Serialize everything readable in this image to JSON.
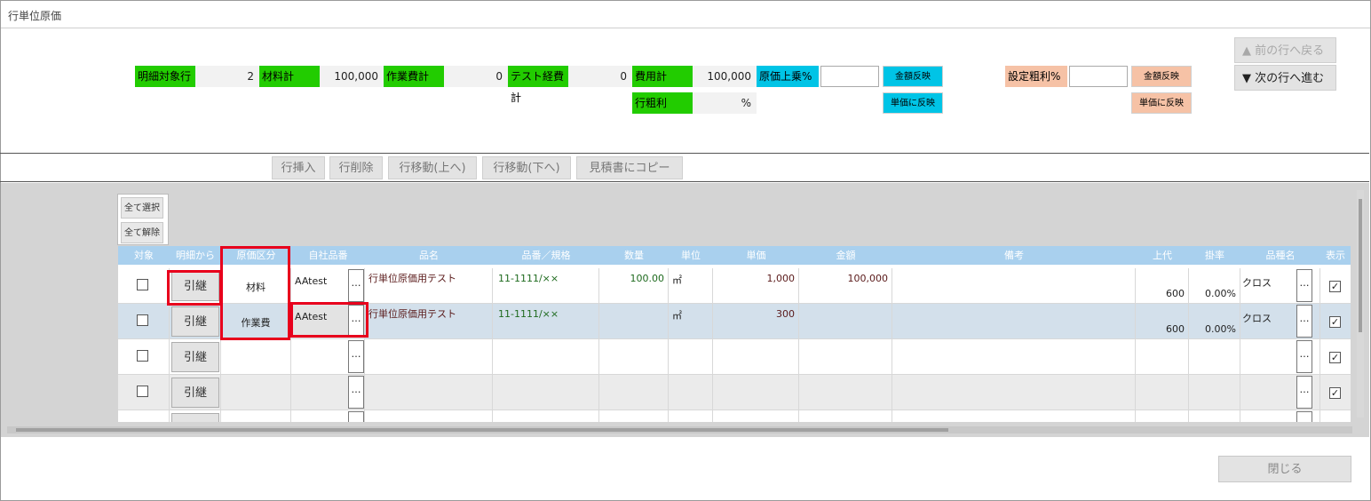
{
  "window": {
    "title": "行単位原価"
  },
  "summary": {
    "row_count_label": "明細対象行",
    "row_count_value": "2",
    "material_label": "材料計",
    "material_value": "100,000",
    "work_label": "作業費計",
    "work_value": "0",
    "test_label": "テスト経費計",
    "test_value": "0",
    "cost_label": "費用計",
    "cost_value": "100,000",
    "gross_label": "行粗利",
    "gross_value": "%",
    "markup_label": "原価上乗%",
    "markup_input": "",
    "markup_amount_btn": "金額反映",
    "markup_unit_btn": "単価に反映",
    "target_margin_label": "設定粗利%",
    "target_margin_input": "",
    "margin_amount_btn": "金額反映",
    "margin_unit_btn": "単価に反映"
  },
  "nav": {
    "prev": "▲ 前の行へ戻る",
    "next": "▼ 次の行へ進む"
  },
  "toolbar": {
    "insert": "行挿入",
    "delete": "行削除",
    "move_up": "行移動(上へ)",
    "move_down": "行移動(下へ)",
    "copy": "見積書にコピー"
  },
  "selection": {
    "select_all": "全て選択",
    "deselect_all": "全て解除"
  },
  "table": {
    "headers": {
      "target": "対象",
      "from_detail": "明細から",
      "cost_type": "原価区分",
      "own_code": "自社品番",
      "name": "品名",
      "spec": "品番／規格",
      "qty": "数量",
      "unit": "単位",
      "unit_price": "単価",
      "amount": "金額",
      "note": "備考",
      "list_price": "上代",
      "rate": "掛率",
      "category": "品種名",
      "display": "表示"
    },
    "rows": [
      {
        "inherit": "引継",
        "cost_type": "材料",
        "own_code": "AAtest",
        "dots1": "…",
        "name": "行単位原価用テスト",
        "spec": "11-1111/××",
        "qty": "100.00",
        "unit": "㎡",
        "unit_price": "1,000",
        "amount": "100,000",
        "note": "",
        "list_price": "600",
        "rate": "0.00%",
        "category": "クロス",
        "dots2": "…",
        "display_checked": true
      },
      {
        "inherit": "引継",
        "cost_type": "作業費",
        "own_code": "AAtest",
        "dots1": "…",
        "name": "行単位原価用テスト",
        "spec": "11-1111/××",
        "qty": "",
        "unit": "㎡",
        "unit_price": "300",
        "amount": "",
        "note": "",
        "list_price": "600",
        "rate": "0.00%",
        "category": "クロス",
        "dots2": "…",
        "display_checked": true
      },
      {
        "inherit": "引継",
        "cost_type": "",
        "own_code": "",
        "dots1": "…",
        "name": "",
        "spec": "",
        "qty": "",
        "unit": "",
        "unit_price": "",
        "amount": "",
        "note": "",
        "list_price": "",
        "rate": "",
        "category": "",
        "dots2": "…",
        "display_checked": true
      },
      {
        "inherit": "引継",
        "cost_type": "",
        "own_code": "",
        "dots1": "…",
        "name": "",
        "spec": "",
        "qty": "",
        "unit": "",
        "unit_price": "",
        "amount": "",
        "note": "",
        "list_price": "",
        "rate": "",
        "category": "",
        "dots2": "…",
        "display_checked": true
      },
      {
        "inherit": "",
        "cost_type": "",
        "own_code": "",
        "dots1": "",
        "name": "",
        "spec": "",
        "qty": "",
        "unit": "",
        "unit_price": "",
        "amount": "",
        "note": "",
        "list_price": "",
        "rate": "",
        "category": "",
        "dots2": "",
        "display_checked": false
      }
    ]
  },
  "footer": {
    "close": "閉じる"
  },
  "colors": {
    "green": "#22cc00",
    "cyan": "#00c4e6",
    "orange": "#f6c2a6",
    "header": "#a9d0ee",
    "highlight": "#e8001c"
  }
}
